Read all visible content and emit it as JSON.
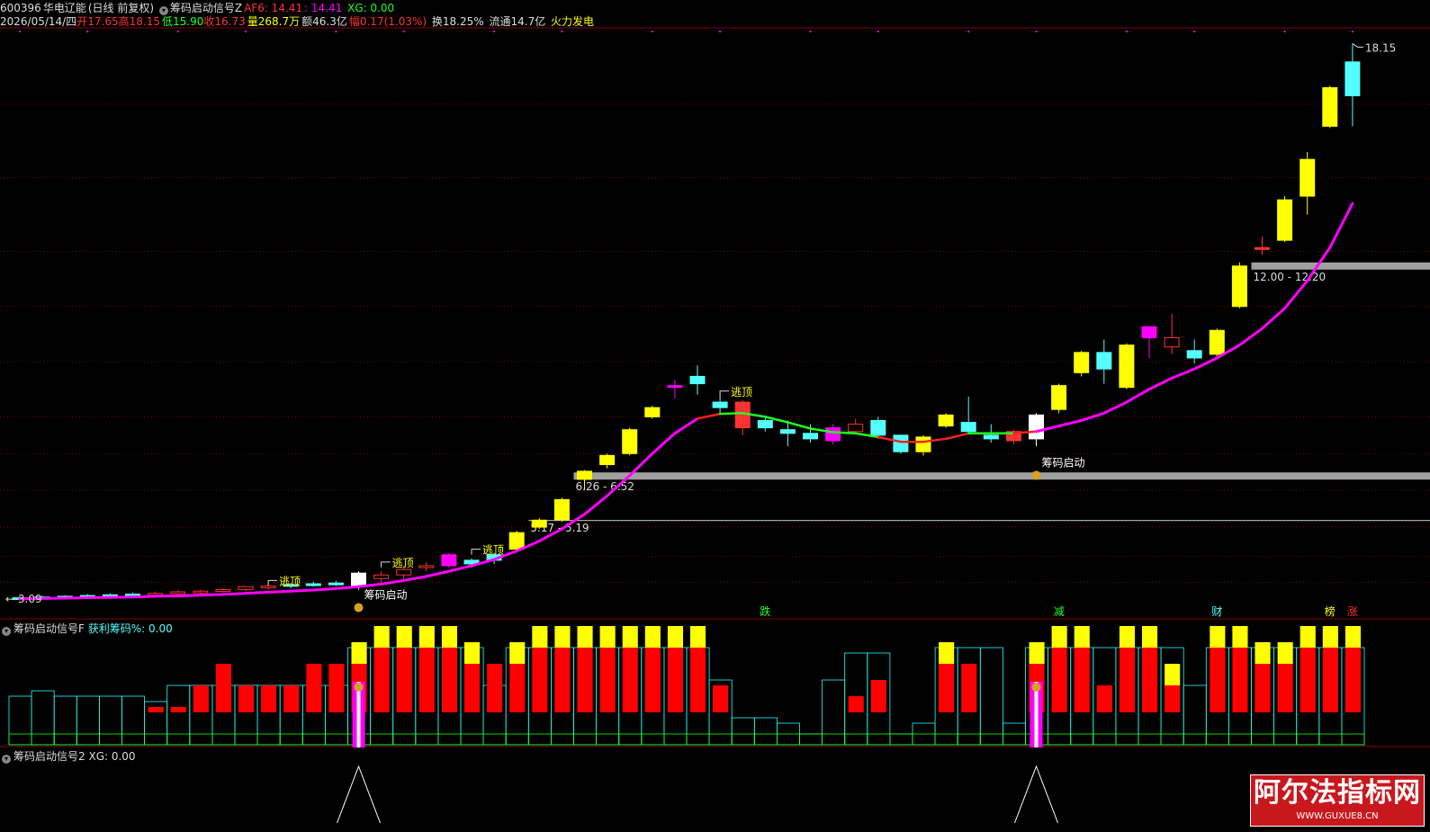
{
  "header": {
    "code": "600396",
    "name": "华电辽能",
    "period": "(日线 前复权)",
    "indicator_name": "筹码启动信号Z",
    "af6_label": "AF6: 14.41",
    "af6_sep": ": 14.41",
    "xg_label": "XG: 0.00"
  },
  "quote": {
    "date": "2026/05/14/四",
    "open_label": "开",
    "open": "17.65",
    "high_label": "高",
    "high": "18.15",
    "low_label": "低",
    "low": "15.90",
    "close_label": "收",
    "close": "16.73",
    "vol_label": "量",
    "vol": "268.7万",
    "amt_label": "额",
    "amt": "46.3亿",
    "chg_label": "幅",
    "chg": "0.17(1.03%)",
    "turnover": "换18.25%",
    "float": "流通14.7亿",
    "concept": "火力发电"
  },
  "panels": {
    "p2_title": "筹码启动信号F",
    "p2_value": "获利筹码%: 0.00",
    "p3_title": "筹码启动信号2",
    "p3_value": "XG: 0.00"
  },
  "watermark": {
    "title": "阿尔法指标网",
    "url": "WWW.GUXUE8.CN"
  },
  "colors": {
    "up": "#ff3232",
    "down": "#54ffff",
    "yellow": "#ffff00",
    "magenta": "#ff00ff",
    "ma_up": "#ff2020",
    "ma_down": "#20ff20",
    "grid": "#800000",
    "zone": "#a0a0a0"
  },
  "chart_data": {
    "type": "candlestick",
    "price_range": [
      2.8,
      18.6
    ],
    "last_high_label": "18.15",
    "left_low_label": "3.09",
    "candles": [
      {
        "o": 3.05,
        "h": 3.12,
        "l": 3.02,
        "c": 3.08,
        "s": "down"
      },
      {
        "o": 3.08,
        "h": 3.14,
        "l": 3.05,
        "c": 3.1,
        "s": "down"
      },
      {
        "o": 3.1,
        "h": 3.15,
        "l": 3.07,
        "c": 3.12,
        "s": "down"
      },
      {
        "o": 3.12,
        "h": 3.18,
        "l": 3.08,
        "c": 3.14,
        "s": "down"
      },
      {
        "o": 3.14,
        "h": 3.2,
        "l": 3.1,
        "c": 3.16,
        "s": "down"
      },
      {
        "o": 3.16,
        "h": 3.22,
        "l": 3.12,
        "c": 3.18,
        "s": "down"
      },
      {
        "o": 3.18,
        "h": 3.25,
        "l": 3.14,
        "c": 3.2,
        "s": "up"
      },
      {
        "o": 3.2,
        "h": 3.28,
        "l": 3.16,
        "c": 3.24,
        "s": "up"
      },
      {
        "o": 3.22,
        "h": 3.3,
        "l": 3.18,
        "c": 3.26,
        "s": "up"
      },
      {
        "o": 3.26,
        "h": 3.34,
        "l": 3.22,
        "c": 3.3,
        "s": "up"
      },
      {
        "o": 3.3,
        "h": 3.4,
        "l": 3.26,
        "c": 3.38,
        "s": "up"
      },
      {
        "o": 3.36,
        "h": 3.44,
        "l": 3.3,
        "c": 3.4,
        "s": "up"
      },
      {
        "o": 3.4,
        "h": 3.48,
        "l": 3.34,
        "c": 3.44,
        "s": "down"
      },
      {
        "o": 3.44,
        "h": 3.52,
        "l": 3.38,
        "c": 3.46,
        "s": "down"
      },
      {
        "o": 3.46,
        "h": 3.54,
        "l": 3.4,
        "c": 3.48,
        "s": "down"
      },
      {
        "o": 3.4,
        "h": 3.8,
        "l": 3.3,
        "c": 3.75,
        "s": "white"
      },
      {
        "o": 3.6,
        "h": 3.8,
        "l": 3.45,
        "c": 3.7,
        "s": "up"
      },
      {
        "o": 3.7,
        "h": 3.95,
        "l": 3.6,
        "c": 3.85,
        "s": "up"
      },
      {
        "o": 3.95,
        "h": 4.05,
        "l": 3.8,
        "c": 3.9,
        "s": "up"
      },
      {
        "o": 3.95,
        "h": 4.3,
        "l": 3.9,
        "c": 4.25,
        "s": "magenta"
      },
      {
        "o": 4.0,
        "h": 4.15,
        "l": 3.9,
        "c": 4.1,
        "s": "down"
      },
      {
        "o": 4.1,
        "h": 4.3,
        "l": 4.0,
        "c": 4.25,
        "s": "down"
      },
      {
        "o": 4.4,
        "h": 4.9,
        "l": 4.35,
        "c": 4.85,
        "s": "yellow"
      },
      {
        "o": 5.0,
        "h": 5.25,
        "l": 4.95,
        "c": 5.19,
        "s": "yellow"
      },
      {
        "o": 5.2,
        "h": 5.8,
        "l": 5.15,
        "c": 5.75,
        "s": "yellow"
      },
      {
        "o": 6.3,
        "h": 6.55,
        "l": 6.0,
        "c": 6.52,
        "s": "yellow"
      },
      {
        "o": 6.7,
        "h": 7.0,
        "l": 6.6,
        "c": 6.95,
        "s": "yellow"
      },
      {
        "o": 7.0,
        "h": 7.7,
        "l": 6.95,
        "c": 7.65,
        "s": "yellow"
      },
      {
        "o": 8.0,
        "h": 8.3,
        "l": 7.95,
        "c": 8.25,
        "s": "yellow"
      },
      {
        "o": 8.8,
        "h": 9.0,
        "l": 8.5,
        "c": 8.85,
        "s": "magenta"
      },
      {
        "o": 8.9,
        "h": 9.4,
        "l": 8.6,
        "c": 9.1,
        "s": "down"
      },
      {
        "o": 8.4,
        "h": 8.6,
        "l": 8.1,
        "c": 8.25,
        "s": "down"
      },
      {
        "o": 8.4,
        "h": 8.45,
        "l": 7.5,
        "c": 7.7,
        "s": "up_fill"
      },
      {
        "o": 7.9,
        "h": 8.0,
        "l": 7.6,
        "c": 7.7,
        "s": "down"
      },
      {
        "o": 7.65,
        "h": 7.9,
        "l": 7.2,
        "c": 7.55,
        "s": "down"
      },
      {
        "o": 7.55,
        "h": 7.8,
        "l": 7.3,
        "c": 7.4,
        "s": "down"
      },
      {
        "o": 7.35,
        "h": 7.8,
        "l": 7.25,
        "c": 7.7,
        "s": "magenta"
      },
      {
        "o": 7.6,
        "h": 7.95,
        "l": 7.55,
        "c": 7.8,
        "s": "up"
      },
      {
        "o": 7.9,
        "h": 8.0,
        "l": 7.4,
        "c": 7.5,
        "s": "down"
      },
      {
        "o": 7.5,
        "h": 7.5,
        "l": 7.0,
        "c": 7.05,
        "s": "down"
      },
      {
        "o": 7.05,
        "h": 7.5,
        "l": 6.95,
        "c": 7.45,
        "s": "yellow"
      },
      {
        "o": 7.75,
        "h": 8.1,
        "l": 7.7,
        "c": 8.05,
        "s": "yellow"
      },
      {
        "o": 7.85,
        "h": 8.55,
        "l": 7.55,
        "c": 7.6,
        "s": "down"
      },
      {
        "o": 7.5,
        "h": 7.8,
        "l": 7.3,
        "c": 7.4,
        "s": "down"
      },
      {
        "o": 7.6,
        "h": 7.65,
        "l": 7.25,
        "c": 7.35,
        "s": "up_fill"
      },
      {
        "o": 7.4,
        "h": 8.1,
        "l": 7.2,
        "c": 8.05,
        "s": "white"
      },
      {
        "o": 8.2,
        "h": 8.9,
        "l": 8.1,
        "c": 8.85,
        "s": "yellow"
      },
      {
        "o": 9.2,
        "h": 9.8,
        "l": 9.1,
        "c": 9.75,
        "s": "yellow"
      },
      {
        "o": 9.75,
        "h": 10.1,
        "l": 8.9,
        "c": 9.3,
        "s": "down"
      },
      {
        "o": 8.8,
        "h": 10.0,
        "l": 8.75,
        "c": 9.95,
        "s": "yellow"
      },
      {
        "o": 10.15,
        "h": 10.4,
        "l": 9.6,
        "c": 10.45,
        "s": "magenta"
      },
      {
        "o": 10.15,
        "h": 10.8,
        "l": 9.7,
        "c": 9.9,
        "s": "up"
      },
      {
        "o": 9.8,
        "h": 10.1,
        "l": 9.45,
        "c": 9.6,
        "s": "down"
      },
      {
        "o": 9.7,
        "h": 10.4,
        "l": 9.65,
        "c": 10.35,
        "s": "yellow"
      },
      {
        "o": 11.0,
        "h": 12.2,
        "l": 10.95,
        "c": 12.1,
        "s": "yellow"
      },
      {
        "o": 12.6,
        "h": 12.9,
        "l": 12.4,
        "c": 12.6,
        "s": "up_fill"
      },
      {
        "o": 12.8,
        "h": 14.0,
        "l": 12.75,
        "c": 13.9,
        "s": "yellow"
      },
      {
        "o": 14.0,
        "h": 15.2,
        "l": 13.5,
        "c": 15.0,
        "s": "yellow"
      },
      {
        "o": 15.9,
        "h": 17.0,
        "l": 15.85,
        "c": 16.95,
        "s": "yellow"
      },
      {
        "o": 17.65,
        "h": 18.15,
        "l": 15.9,
        "c": 16.73,
        "s": "down"
      }
    ],
    "ma": [
      3.05,
      3.06,
      3.07,
      3.08,
      3.09,
      3.1,
      3.12,
      3.13,
      3.15,
      3.17,
      3.2,
      3.23,
      3.26,
      3.29,
      3.33,
      3.38,
      3.45,
      3.55,
      3.66,
      3.8,
      3.95,
      4.12,
      4.35,
      4.62,
      4.95,
      5.35,
      5.85,
      6.4,
      7.0,
      7.55,
      7.95,
      8.08,
      8.1,
      8.0,
      7.85,
      7.68,
      7.58,
      7.55,
      7.45,
      7.32,
      7.32,
      7.4,
      7.55,
      7.55,
      7.55,
      7.6,
      7.75,
      7.9,
      8.1,
      8.4,
      8.75,
      9.05,
      9.3,
      9.6,
      9.95,
      10.4,
      10.95,
      11.7,
      12.6,
      13.8
    ],
    "ma_green_segments": [
      [
        31,
        38
      ],
      [
        42,
        44
      ]
    ],
    "zones": [
      {
        "y": 6.39,
        "label": "6.26 - 6.52",
        "from": 25
      },
      {
        "y": 5.18,
        "label": "5.17 - 5.19",
        "from": 23
      },
      {
        "y": 12.1,
        "label": "12.00 - 12.20",
        "from": 55
      }
    ],
    "marks": [
      {
        "i": 11,
        "text": "逃顶",
        "y": 3.55
      },
      {
        "i": 16,
        "text": "逃顶",
        "y": 4.05
      },
      {
        "i": 20,
        "text": "逃顶",
        "y": 4.4
      },
      {
        "i": 31,
        "text": "逃顶",
        "y": 8.7
      },
      {
        "i": 15,
        "text": "筹码启动",
        "y": 3.3
      },
      {
        "i": 45,
        "text": "筹码启动",
        "y": 6.9
      }
    ],
    "bottom_tags": [
      {
        "i": 33,
        "text": "跌",
        "color": "#20ff20"
      },
      {
        "i": 46,
        "text": "减",
        "color": "#20ff20"
      },
      {
        "i": 53,
        "text": "财",
        "color": "#54ffff"
      },
      {
        "i": 58,
        "text": "榜",
        "color": "#ffff00"
      },
      {
        "i": 59,
        "text": "涨",
        "color": "#ff3232"
      }
    ],
    "f_panel": {
      "profit_top": [
        0,
        0,
        0,
        0,
        0,
        0,
        0,
        0,
        0,
        0,
        0,
        0,
        0,
        0,
        0,
        35,
        25,
        40,
        40,
        40,
        40,
        0,
        40,
        40,
        40,
        40,
        40,
        40,
        40,
        40,
        25,
        0,
        0,
        0,
        0,
        0,
        0,
        0,
        0,
        0,
        0,
        25,
        0,
        0,
        0,
        35,
        40,
        40,
        0,
        35,
        40,
        40,
        0,
        40,
        40,
        40,
        40,
        40,
        40,
        25
      ],
      "profit_red": [
        0,
        0,
        0,
        0,
        0,
        0,
        5,
        5,
        25,
        45,
        25,
        25,
        25,
        45,
        45,
        45,
        60,
        60,
        60,
        60,
        45,
        45,
        45,
        60,
        60,
        60,
        60,
        60,
        60,
        60,
        60,
        25,
        0,
        0,
        0,
        0,
        0,
        15,
        30,
        0,
        0,
        45,
        45,
        0,
        0,
        45,
        60,
        60,
        25,
        60,
        60,
        25,
        0,
        60,
        60,
        45,
        45,
        60,
        60,
        60
      ],
      "env": [
        35,
        40,
        35,
        35,
        35,
        35,
        30,
        45,
        45,
        45,
        45,
        45,
        45,
        45,
        45,
        80,
        80,
        80,
        80,
        80,
        80,
        45,
        80,
        80,
        80,
        80,
        80,
        80,
        80,
        80,
        80,
        50,
        15,
        15,
        10,
        0,
        50,
        75,
        75,
        0,
        10,
        80,
        80,
        80,
        10,
        80,
        80,
        80,
        80,
        80,
        80,
        80,
        45,
        80,
        80,
        80,
        80,
        80,
        80,
        80
      ]
    },
    "signals": [
      15,
      45
    ]
  }
}
